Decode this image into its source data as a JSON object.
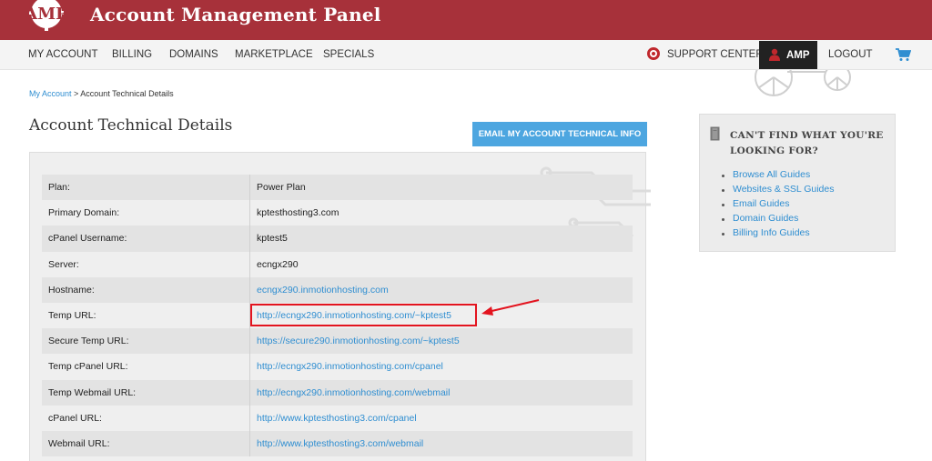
{
  "header": {
    "logo_text": "AMP",
    "title": "Account Management Panel",
    "brand_color": "#a7313a"
  },
  "nav": {
    "items": [
      "MY ACCOUNT",
      "BILLING",
      "DOMAINS",
      "MARKETPLACE",
      "SPECIALS"
    ],
    "support_label": "SUPPORT CENTER",
    "amp_label": "AMP",
    "logout_label": "LOGOUT",
    "cart_icon": "cart-icon"
  },
  "breadcrumb": {
    "link": "My Account",
    "separator": " > ",
    "current": "Account Technical Details"
  },
  "page": {
    "title": "Account Technical Details",
    "email_button": "EMAIL MY ACCOUNT TECHNICAL INFO"
  },
  "details": [
    {
      "label": "Plan:",
      "value": "Power Plan"
    },
    {
      "label": "Primary Domain:",
      "value": "kptesthosting3.com"
    },
    {
      "label": "cPanel Username:",
      "value": "kptest5"
    },
    {
      "label": "Server:",
      "value": "ecngx290"
    },
    {
      "label": "Hostname:",
      "value": "ecngx290.inmotionhosting.com"
    },
    {
      "label": "Temp URL:",
      "value": "http://ecngx290.inmotionhosting.com/~kptest5"
    },
    {
      "label": "Secure Temp URL:",
      "value": "https://secure290.inmotionhosting.com/~kptest5"
    },
    {
      "label": "Temp cPanel URL:",
      "value": "http://ecngx290.inmotionhosting.com/cpanel"
    },
    {
      "label": "Temp Webmail URL:",
      "value": "http://ecngx290.inmotionhosting.com/webmail"
    },
    {
      "label": "cPanel URL:",
      "value": "http://www.kptesthosting3.com/cpanel"
    },
    {
      "label": "Webmail URL:",
      "value": "http://www.kptesthosting3.com/webmail"
    }
  ],
  "help": {
    "title": "CAN'T FIND WHAT YOU'RE LOOKING FOR?",
    "links": [
      "Browse All Guides",
      "Websites & SSL Guides",
      "Email Guides",
      "Domain Guides",
      "Billing Info Guides"
    ]
  },
  "colors": {
    "link": "#2f8ed1",
    "highlight": "#e3141f",
    "button": "#4da6e0"
  }
}
